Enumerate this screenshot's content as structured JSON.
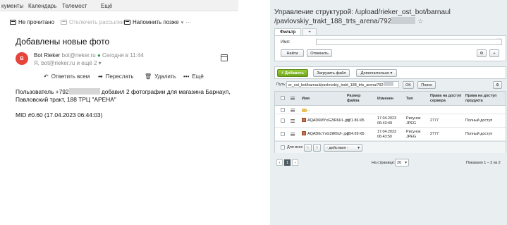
{
  "mail": {
    "top_menu": [
      "кументы",
      "Календарь",
      "Телемост",
      "Ещё"
    ],
    "toolbar": {
      "unread": "Не прочитано",
      "unsubscribe": "Отключить рассылки",
      "remind": "Напомнить позже",
      "more": "⋯"
    },
    "subject": "Добавлены новые фото",
    "avatar_letter": "B",
    "sender_name": "Bot Rieker",
    "sender_email": "bot@rieker.ru",
    "date": "Сегодня в 11:44",
    "recipients": "Я, bot@rieker.ru и ещё 2",
    "actions": {
      "reply_all": "Ответить всем",
      "forward": "Переслать",
      "delete": "Удалить",
      "more": "Ещё"
    },
    "body_line1_a": "Пользователь +792",
    "body_line1_b": "добавил 2 фотографии для магазина Барнаул,",
    "body_line2": "Павловский тракт, 188 ТРЦ \"АРЕНА\"",
    "mid": "MID #0.60 (17.04.2023 06:44:03)"
  },
  "fm": {
    "title_line1": "Управление структурой: /upload/rieker_ost_bot/barnaul",
    "title_line2": "/pavlovskiy_trakt_188_trts_arena/792",
    "filter_tab": "Фильтр",
    "add_tab": "+",
    "name_label": "Имя:",
    "find_btn": "Найти",
    "cancel_btn": "Отменить",
    "add_btn": "+ Добавить",
    "upload_btn": "Загрузить файл",
    "extra_btn": "Дополнительно",
    "path_label": "Путь:",
    "path_value": "er_ost_bot/barnaul/pavlovskiy_trakt_188_trts_arena/792",
    "ok_btn": "OK",
    "search_btn": "Поиск",
    "columns": [
      "Имя",
      "Размер файла",
      "Изменен",
      "Тип",
      "Права на доступ сервера",
      "Права на доступ продукта"
    ],
    "parent_row": "..",
    "rows": [
      {
        "name": "AQAD6MYxG2tR6UI-.jpg",
        "size": "171.86 КБ",
        "date": "17.04.2023",
        "time": "06:43:49",
        "type1": "Рисунок",
        "type2": "JPEG",
        "server": "2777",
        "product": "Полный доступ"
      },
      {
        "name": "AQAD6cYxG2tR6UI-.jpg",
        "size": "254.69 КБ",
        "date": "17.04.2023",
        "time": "06:43:50",
        "type1": "Рисунок",
        "type2": "JPEG",
        "server": "2777",
        "product": "Полный доступ"
      }
    ],
    "for_all": "Для всех",
    "actions_select": "- действия -",
    "per_page_label": "На странице:",
    "per_page": "20",
    "shown": "Показано 1 – 2 из 2",
    "page": "1"
  }
}
